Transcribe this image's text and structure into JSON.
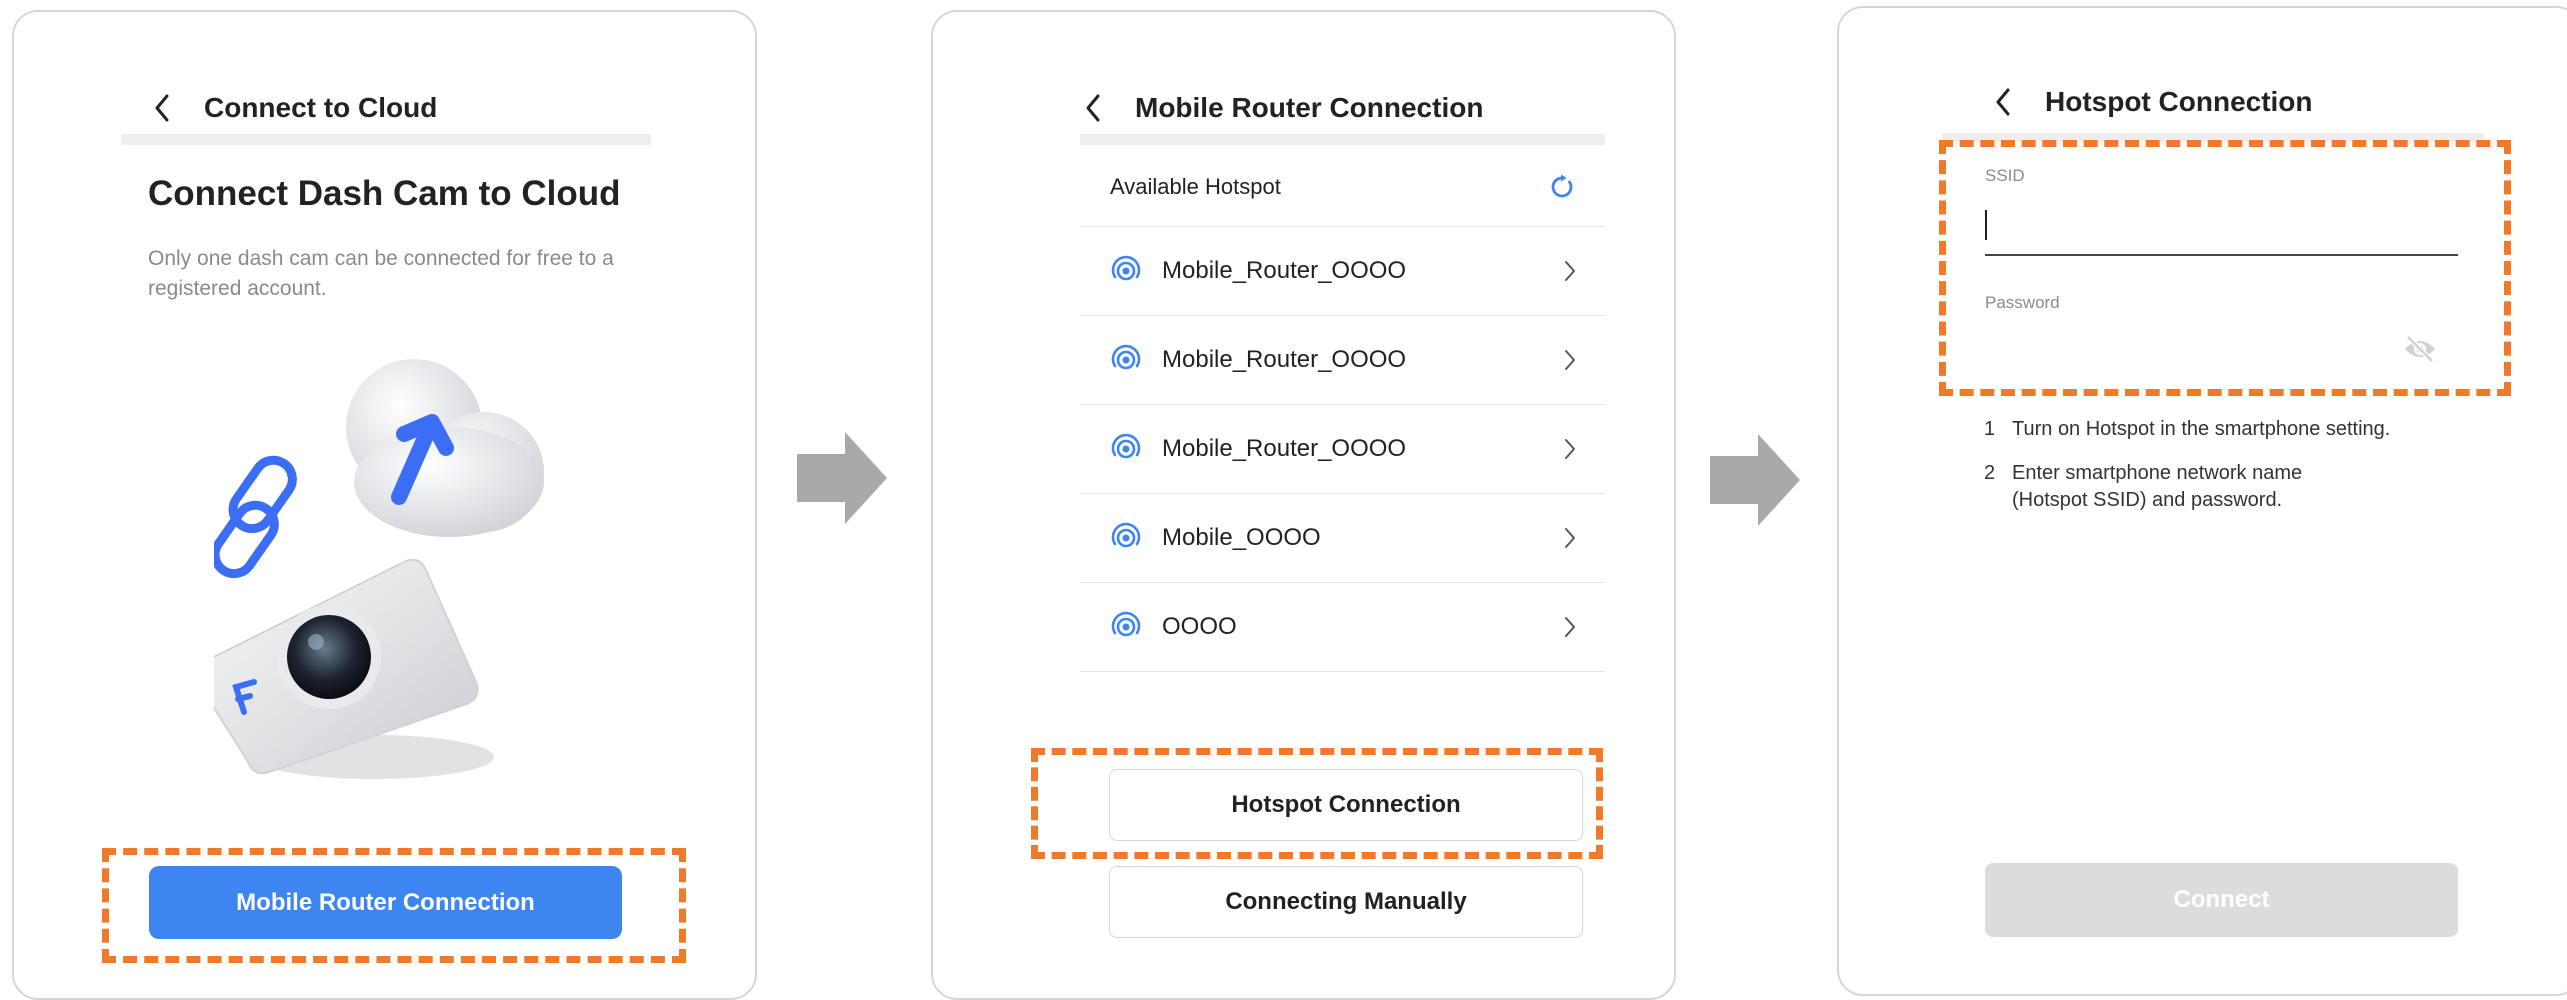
{
  "panel1": {
    "header_title": "Connect to Cloud",
    "title": "Connect Dash Cam to Cloud",
    "subtitle": "Only one dash cam can be connected for free to a registered account.",
    "primary_button": "Mobile Router Connection"
  },
  "panel2": {
    "header_title": "Mobile Router Connection",
    "list_header": "Available Hotspot",
    "hotspots": [
      "Mobile_Router_OOOO",
      "Mobile_Router_OOOO",
      "Mobile_Router_OOOO",
      "Mobile_OOOO",
      "OOOO"
    ],
    "hotspot_button": "Hotspot Connection",
    "manual_button": "Connecting Manually"
  },
  "panel3": {
    "header_title": "Hotspot Connection",
    "ssid_label": "SSID",
    "password_label": "Password",
    "steps": [
      {
        "num": "1",
        "text": "Turn on Hotspot in the smartphone setting."
      },
      {
        "num": "2",
        "text": "Enter smartphone network name\n(Hotspot SSID) and password."
      }
    ],
    "connect_button": "Connect"
  },
  "colors": {
    "accent": "#3d85f0",
    "highlight_dash": "#f07a2a",
    "arrow": "#a9a9a9",
    "disabled": "#dcdcdc"
  }
}
